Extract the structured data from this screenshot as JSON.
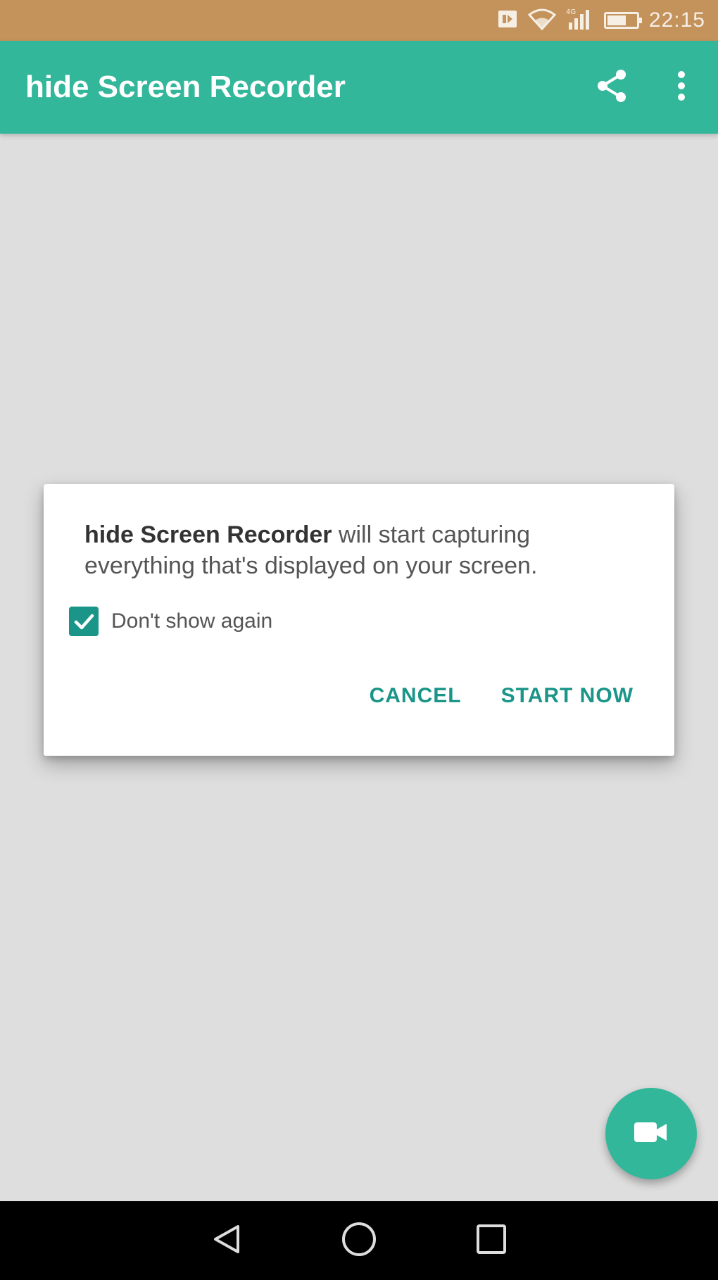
{
  "status_bar": {
    "time": "22:15",
    "icons": [
      "notification-icon",
      "wifi-icon",
      "signal-icon",
      "battery-icon"
    ]
  },
  "app_bar": {
    "title": "hide Screen Recorder",
    "actions": [
      "share-icon",
      "more-vert-icon"
    ]
  },
  "dialog": {
    "app_name": "hide Screen Recorder",
    "message": " will start capturing everything that's displayed on your screen.",
    "checkbox_label": "Don't show again",
    "checkbox_checked": true,
    "cancel_label": "CANCEL",
    "confirm_label": "START NOW"
  },
  "fab": {
    "icon": "videocam-icon"
  },
  "nav_bar": {
    "buttons": [
      "back-icon",
      "home-icon",
      "recents-icon"
    ]
  },
  "colors": {
    "status_bar": "#c4935c",
    "accent": "#33b79b",
    "accent_dark": "#1b9588",
    "scrim": "#dedede"
  }
}
